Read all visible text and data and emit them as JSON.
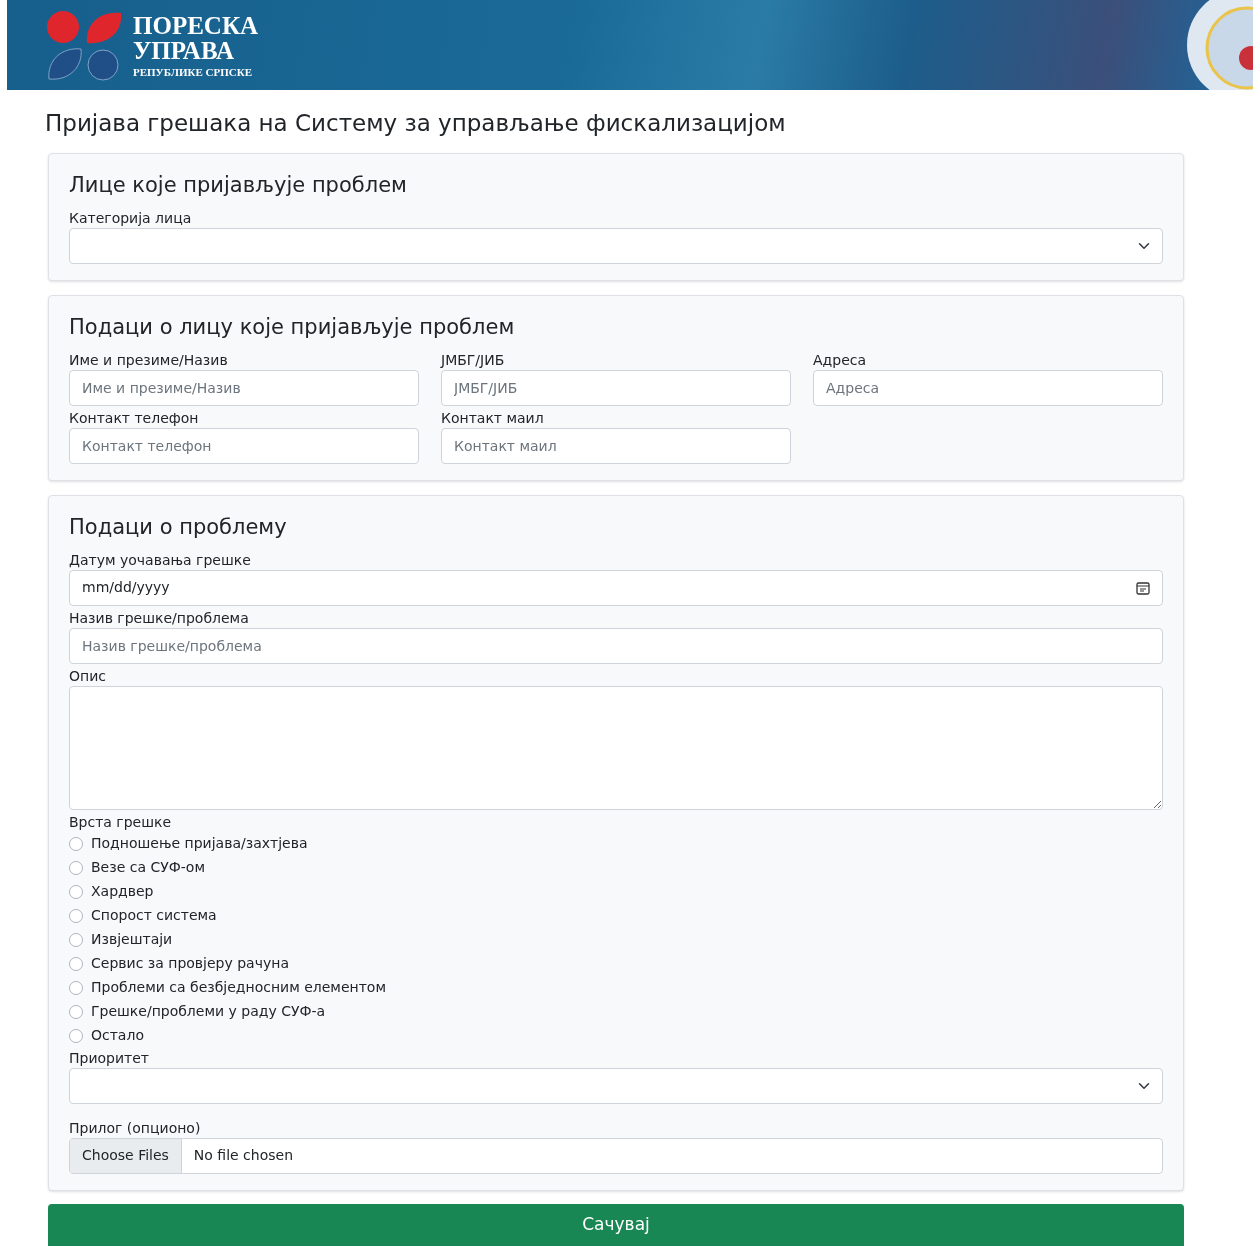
{
  "header": {
    "logo_line_1": "ПОРЕСКА",
    "logo_line_2": "УПРАВА",
    "logo_line_3": "РЕПУБЛИКЕ СРПСКЕ"
  },
  "page_title": "Пријава грешака на Систему за управљање фискализацијом",
  "person_section": {
    "title": "Лице које пријављује проблем",
    "category": {
      "label": "Категорија лица"
    }
  },
  "details_section": {
    "title": "Подаци о лицу које пријављује проблем",
    "fields": [
      {
        "label": "Име и презиме/Назив",
        "placeholder": "Име и презиме/Назив"
      },
      {
        "label": "ЈМБГ/ЈИБ",
        "placeholder": "ЈМБГ/ЈИБ"
      },
      {
        "label": "Адреса",
        "placeholder": "Адреса"
      },
      {
        "label": "Контакт телефон",
        "placeholder": "Контакт телефон"
      },
      {
        "label": "Контакт маил",
        "placeholder": "Контакт маил"
      }
    ]
  },
  "problem_section": {
    "title": "Подаци о проблему",
    "date": {
      "label": "Датум уочавања грешке",
      "value": "mm/dd/yyyy"
    },
    "name": {
      "label": "Назив грешке/проблема",
      "placeholder": "Назив грешке/проблема"
    },
    "description": {
      "label": "Опис"
    },
    "error_type": {
      "label": "Врста грешке",
      "options": [
        {
          "label": "Подношење пријава/захтјева",
          "selected": false
        },
        {
          "label": "Везе са СУФ-ом",
          "selected": false
        },
        {
          "label": "Хардвер",
          "selected": false
        },
        {
          "label": "Спорост система",
          "selected": false
        },
        {
          "label": "Извјештаји",
          "selected": false
        },
        {
          "label": "Сервис за провјеру рачуна",
          "selected": false
        },
        {
          "label": "Проблеми са безбједносним елементом",
          "selected": false
        },
        {
          "label": "Грешке/проблеми у раду СУФ-а",
          "selected": false
        },
        {
          "label": "Остало",
          "selected": false
        }
      ]
    },
    "priority": {
      "label": "Приоритет"
    },
    "attachment": {
      "label": "Прилог (опционо)",
      "button": "Choose Files",
      "status": "No file chosen"
    }
  },
  "save_button": "Сачувај"
}
